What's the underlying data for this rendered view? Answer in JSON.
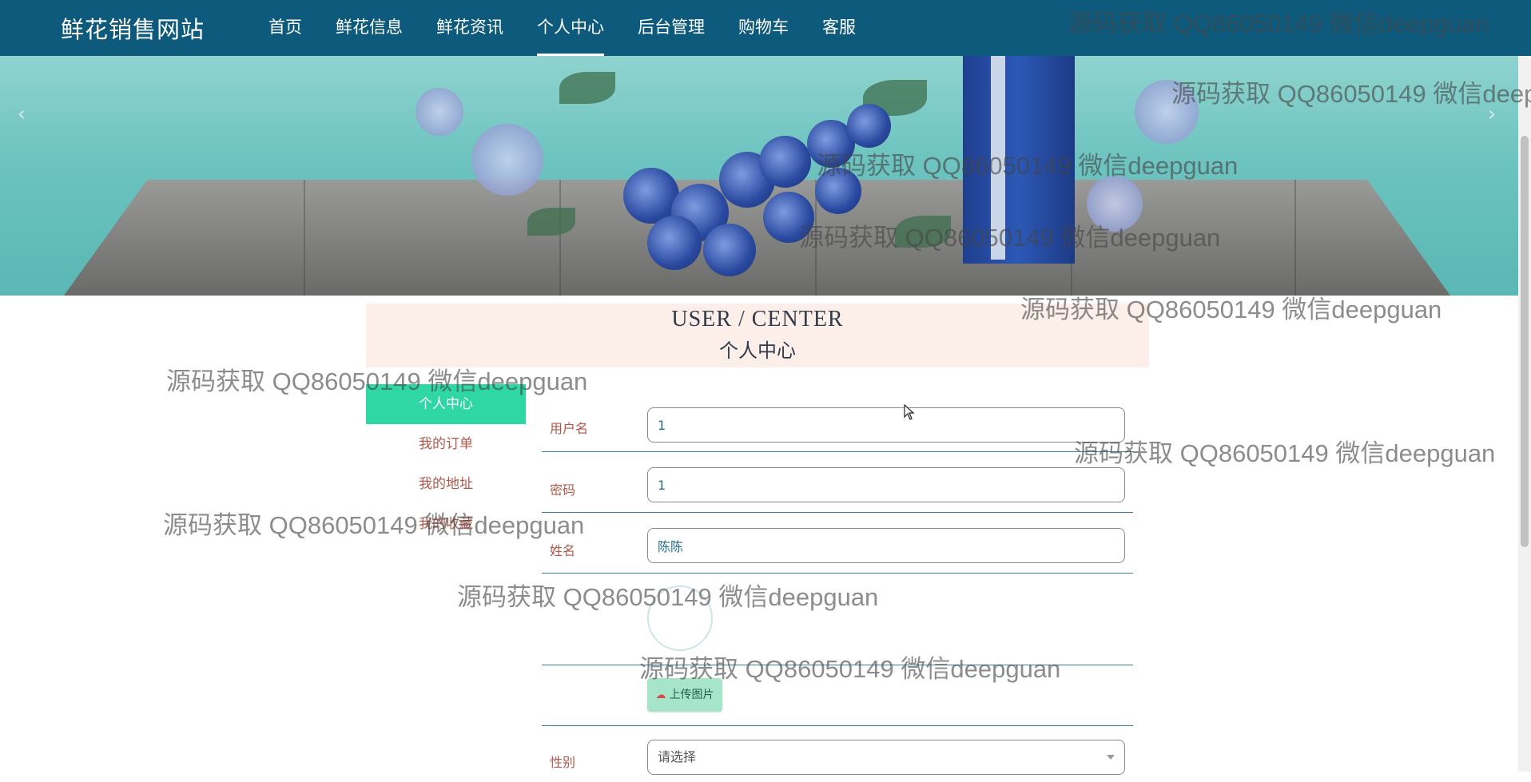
{
  "nav": {
    "brand": "鲜花销售网站",
    "items": [
      {
        "label": "首页"
      },
      {
        "label": "鲜花信息"
      },
      {
        "label": "鲜花资讯"
      },
      {
        "label": "个人中心",
        "active": true
      },
      {
        "label": "后台管理"
      },
      {
        "label": "购物车"
      },
      {
        "label": "客服"
      }
    ]
  },
  "banner": {
    "prev_icon": "chevron-left-icon",
    "next_icon": "chevron-right-icon"
  },
  "title": {
    "en": "USER / CENTER",
    "zh": "个人中心"
  },
  "side_menu": {
    "items": [
      {
        "label": "个人中心",
        "active": true
      },
      {
        "label": "我的订单"
      },
      {
        "label": "我的地址"
      },
      {
        "label": "我的收藏"
      }
    ]
  },
  "form": {
    "username": {
      "label": "用户名",
      "value": "1"
    },
    "password": {
      "label": "密码",
      "value": "1"
    },
    "name": {
      "label": "姓名",
      "value": "陈陈"
    },
    "upload_label": "上传图片",
    "gender": {
      "label": "性别",
      "placeholder": "请选择"
    }
  },
  "watermark_text": "源码获取 QQ86050149 微信deepguan",
  "colors": {
    "nav_bg": "#0d5a7c",
    "accent_green": "#2fd7a4",
    "title_bg": "#fcefe9",
    "label_color": "#b0594b"
  }
}
